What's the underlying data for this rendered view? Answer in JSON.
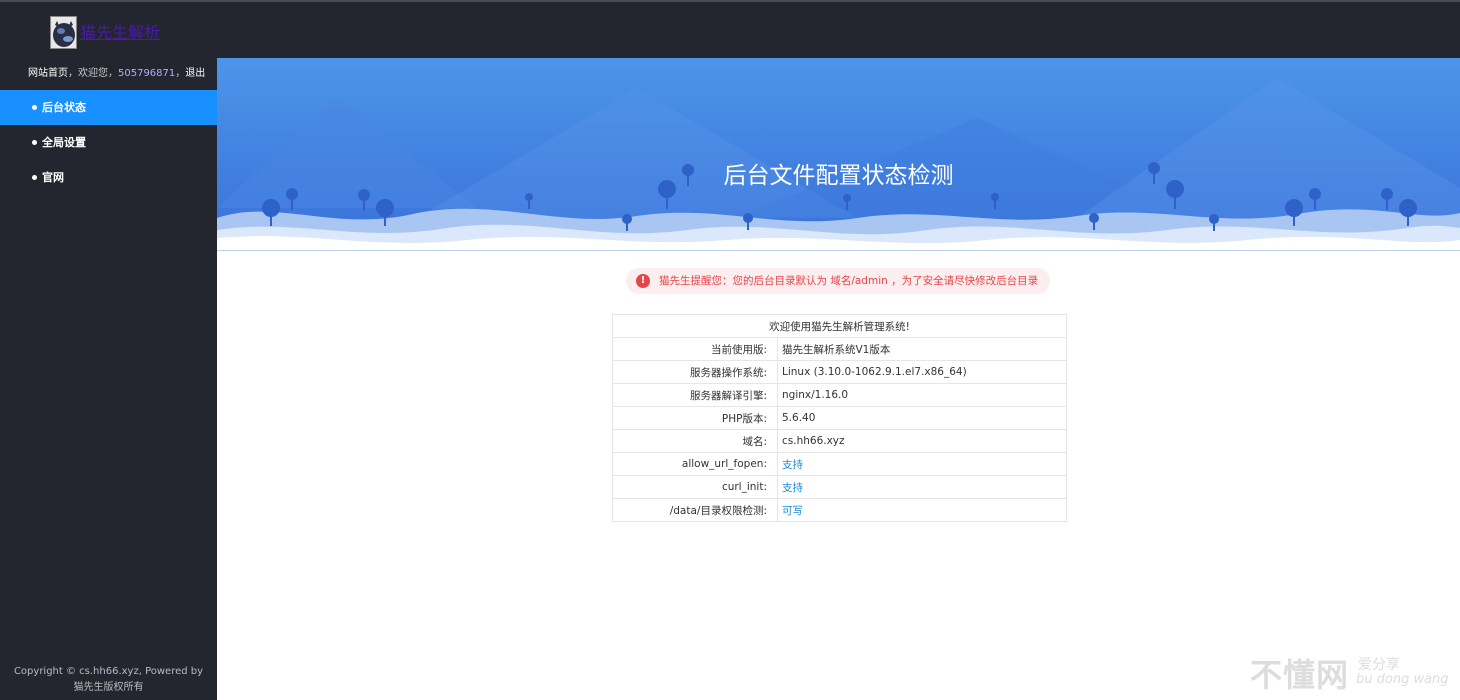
{
  "site": {
    "logo_title": "猫先生解析"
  },
  "userbar": {
    "home": "网站首页",
    "welcome": "欢迎您，",
    "user_id": "505796871",
    "logout": "退出"
  },
  "nav": {
    "items": [
      {
        "label": "后台状态"
      },
      {
        "label": "全局设置"
      },
      {
        "label": "官网"
      }
    ]
  },
  "footer": {
    "line1": "Copyright © cs.hh66.xyz, Powered by",
    "line2": "猫先生版权所有"
  },
  "banner": {
    "title": "后台文件配置状态检测"
  },
  "notice": {
    "icon": "exclamation-icon",
    "text": "猫先生提醒您：您的后台目录默认为 域名/admin ，为了安全请尽快修改后台目录"
  },
  "table": {
    "header": "欢迎使用猫先生解析管理系统!",
    "rows": [
      {
        "key": "当前使用版:",
        "value": "猫先生解析系统V1版本",
        "status": false
      },
      {
        "key": "服务器操作系统:",
        "value": "Linux (3.10.0-1062.9.1.el7.x86_64)",
        "status": false
      },
      {
        "key": "服务器解译引擎:",
        "value": "nginx/1.16.0",
        "status": false
      },
      {
        "key": "PHP版本:",
        "value": "5.6.40",
        "status": false
      },
      {
        "key": "域名:",
        "value": "cs.hh66.xyz",
        "status": false
      },
      {
        "key": "allow_url_fopen:",
        "value": "支持",
        "status": true
      },
      {
        "key": "curl_init:",
        "value": "支持",
        "status": true
      },
      {
        "key": "/data/目录权限检测:",
        "value": "可写",
        "status": true
      }
    ]
  },
  "watermark": {
    "big": "不懂网",
    "small": "爱分享",
    "pinyin": "bu dong wang"
  },
  "colors": {
    "sidebar": "#23262e",
    "active": "#1890ff",
    "banner_top": "#4a8fe6",
    "link": "#1e8bd6",
    "warning": "#e6454a"
  }
}
